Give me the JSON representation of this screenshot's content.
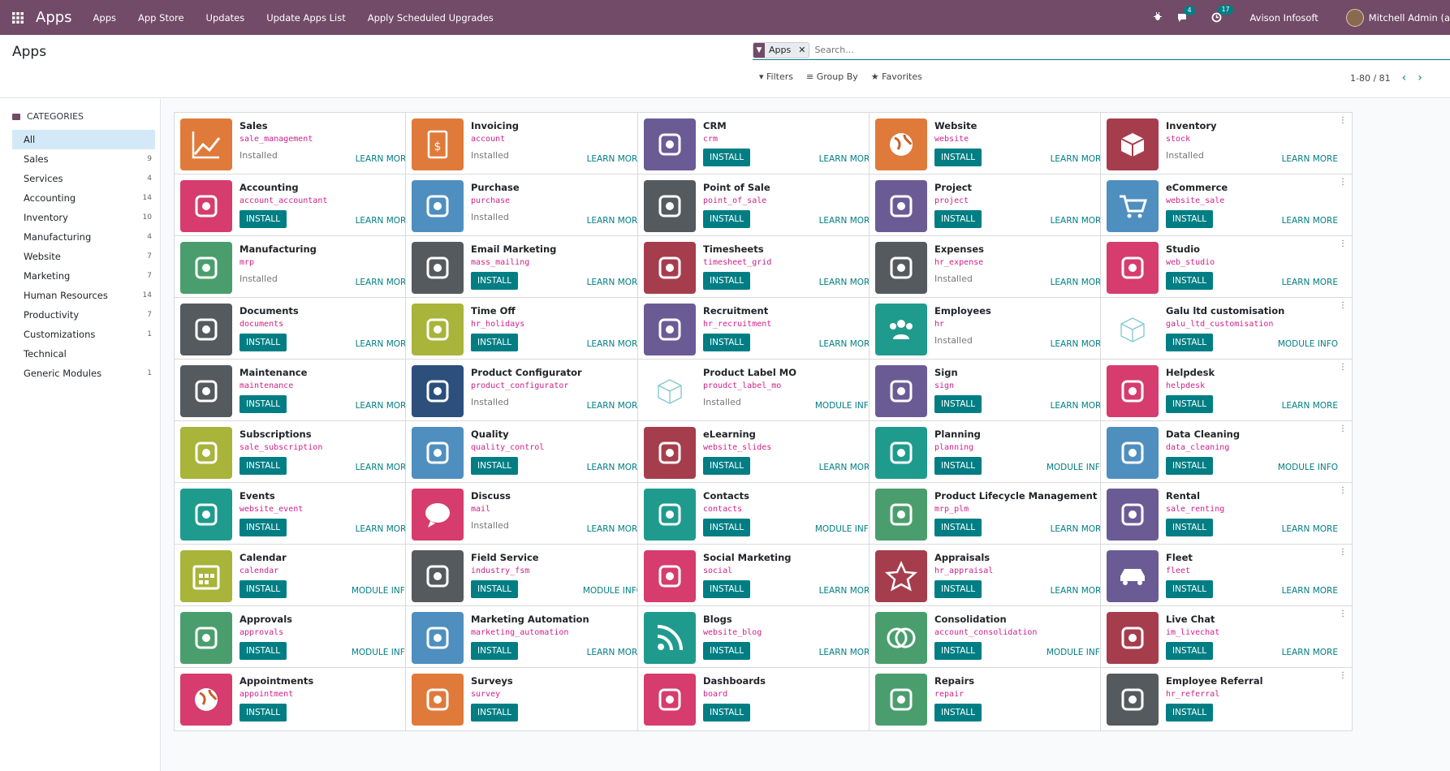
{
  "topbar": {
    "brand": "Apps",
    "menu": [
      "Apps",
      "App Store",
      "Updates",
      "Update Apps List",
      "Apply Scheduled Upgrades"
    ],
    "messages_count": "4",
    "activities_count": "17",
    "company": "Avison Infosoft",
    "user": "Mitchell Admin (a"
  },
  "control": {
    "title": "Apps",
    "facet_label": "Apps",
    "search_placeholder": "Search...",
    "filters": "Filters",
    "group_by": "Group By",
    "favorites": "Favorites",
    "pager": "1-80 / 81"
  },
  "sidebar": {
    "heading": "CATEGORIES",
    "items": [
      {
        "label": "All",
        "count": ""
      },
      {
        "label": "Sales",
        "count": "9"
      },
      {
        "label": "Services",
        "count": "4"
      },
      {
        "label": "Accounting",
        "count": "14"
      },
      {
        "label": "Inventory",
        "count": "10"
      },
      {
        "label": "Manufacturing",
        "count": "4"
      },
      {
        "label": "Website",
        "count": "7"
      },
      {
        "label": "Marketing",
        "count": "7"
      },
      {
        "label": "Human Resources",
        "count": "14"
      },
      {
        "label": "Productivity",
        "count": "7"
      },
      {
        "label": "Customizations",
        "count": "1"
      },
      {
        "label": "Technical",
        "count": ""
      },
      {
        "label": "Generic Modules",
        "count": "1"
      }
    ]
  },
  "labels": {
    "install": "INSTALL",
    "installed": "Installed"
  },
  "apps": [
    {
      "name": "Sales",
      "tech": "sale_management",
      "installed": true,
      "link": "LEARN MORE",
      "color": "#e07a3a",
      "icon": "chart-icon"
    },
    {
      "name": "Invoicing",
      "tech": "account",
      "installed": true,
      "link": "LEARN MORE",
      "color": "#e07a3a",
      "icon": "invoice-icon"
    },
    {
      "name": "CRM",
      "tech": "crm",
      "installed": false,
      "link": "LEARN MORE",
      "color": "#6b5b95",
      "icon": "handshake-icon"
    },
    {
      "name": "Website",
      "tech": "website",
      "installed": false,
      "link": "LEARN MORE",
      "color": "#e07a3a",
      "icon": "globe-icon"
    },
    {
      "name": "Inventory",
      "tech": "stock",
      "installed": true,
      "link": "LEARN MORE",
      "color": "#a63d4d",
      "icon": "box-icon"
    },
    {
      "name": "Accounting",
      "tech": "account_accountant",
      "installed": false,
      "link": "LEARN MORE",
      "color": "#d63c6e",
      "icon": "document-gear-icon"
    },
    {
      "name": "Purchase",
      "tech": "purchase",
      "installed": true,
      "link": "LEARN MORE",
      "color": "#4f8fbf",
      "icon": "card-icon"
    },
    {
      "name": "Point of Sale",
      "tech": "point_of_sale",
      "installed": false,
      "link": "LEARN MORE",
      "color": "#555a5e",
      "icon": "shop-icon"
    },
    {
      "name": "Project",
      "tech": "project",
      "installed": false,
      "link": "LEARN MORE",
      "color": "#6b5b95",
      "icon": "puzzle-icon"
    },
    {
      "name": "eCommerce",
      "tech": "website_sale",
      "installed": false,
      "link": "LEARN MORE",
      "color": "#4f8fbf",
      "icon": "cart-icon"
    },
    {
      "name": "Manufacturing",
      "tech": "mrp",
      "installed": true,
      "link": "LEARN MORE",
      "color": "#4a9e6e",
      "icon": "wrench-icon"
    },
    {
      "name": "Email Marketing",
      "tech": "mass_mailing",
      "installed": false,
      "link": "LEARN MORE",
      "color": "#555a5e",
      "icon": "paper-plane-icon"
    },
    {
      "name": "Timesheets",
      "tech": "timesheet_grid",
      "installed": false,
      "link": "LEARN MORE",
      "color": "#a63d4d",
      "icon": "stopwatch-icon"
    },
    {
      "name": "Expenses",
      "tech": "hr_expense",
      "installed": true,
      "link": "LEARN MORE",
      "color": "#555a5e",
      "icon": "person-dollar-icon"
    },
    {
      "name": "Studio",
      "tech": "web_studio",
      "installed": false,
      "link": "LEARN MORE",
      "color": "#d63c6e",
      "icon": "tools-icon"
    },
    {
      "name": "Documents",
      "tech": "documents",
      "installed": false,
      "link": "LEARN MORE",
      "color": "#555a5e",
      "icon": "inbox-icon"
    },
    {
      "name": "Time Off",
      "tech": "hr_holidays",
      "installed": false,
      "link": "LEARN MORE",
      "color": "#a8b43a",
      "icon": "person-sun-icon"
    },
    {
      "name": "Recruitment",
      "tech": "hr_recruitment",
      "installed": false,
      "link": "LEARN MORE",
      "color": "#6b5b95",
      "icon": "magnifier-icon"
    },
    {
      "name": "Employees",
      "tech": "hr",
      "installed": true,
      "link": "LEARN MORE",
      "color": "#1f9b8e",
      "icon": "people-icon"
    },
    {
      "name": "Galu ltd customisation",
      "tech": "galu_ltd_customisation",
      "installed": false,
      "link": "MODULE INFO",
      "color": "#ffffff",
      "icon": "cube-outline-icon"
    },
    {
      "name": "Maintenance",
      "tech": "maintenance",
      "installed": false,
      "link": "LEARN MORE",
      "color": "#555a5e",
      "icon": "hammer-icon"
    },
    {
      "name": "Product Configurator",
      "tech": "product_configurator",
      "installed": true,
      "link": "LEARN MORE",
      "color": "#2c4f7c",
      "icon": "monitor-gear-icon"
    },
    {
      "name": "Product Label MO",
      "tech": "proudct_label_mo",
      "installed": true,
      "link": "MODULE INFO",
      "color": "#ffffff",
      "icon": "cube-outline-icon"
    },
    {
      "name": "Sign",
      "tech": "sign",
      "installed": false,
      "link": "LEARN MORE",
      "color": "#6b5b95",
      "icon": "signature-icon"
    },
    {
      "name": "Helpdesk",
      "tech": "helpdesk",
      "installed": false,
      "link": "LEARN MORE",
      "color": "#d63c6e",
      "icon": "lifebuoy-icon"
    },
    {
      "name": "Subscriptions",
      "tech": "sale_subscription",
      "installed": false,
      "link": "LEARN MORE",
      "color": "#a8b43a",
      "icon": "recurring-dollar-icon"
    },
    {
      "name": "Quality",
      "tech": "quality_control",
      "installed": false,
      "link": "LEARN MORE",
      "color": "#4f8fbf",
      "icon": "quality-badge-icon"
    },
    {
      "name": "eLearning",
      "tech": "website_slides",
      "installed": false,
      "link": "LEARN MORE",
      "color": "#a63d4d",
      "icon": "presenter-icon"
    },
    {
      "name": "Planning",
      "tech": "planning",
      "installed": false,
      "link": "MODULE INFO",
      "color": "#1f9b8e",
      "icon": "planning-icon"
    },
    {
      "name": "Data Cleaning",
      "tech": "data_cleaning",
      "installed": false,
      "link": "MODULE INFO",
      "color": "#4f8fbf",
      "icon": "broom-icon"
    },
    {
      "name": "Events",
      "tech": "website_event",
      "installed": false,
      "link": "LEARN MORE",
      "color": "#1f9b8e",
      "icon": "tickets-icon"
    },
    {
      "name": "Discuss",
      "tech": "mail",
      "installed": true,
      "link": "LEARN MORE",
      "color": "#d63c6e",
      "icon": "chat-bubble-icon"
    },
    {
      "name": "Contacts",
      "tech": "contacts",
      "installed": false,
      "link": "MODULE INFO",
      "color": "#1f9b8e",
      "icon": "address-book-icon"
    },
    {
      "name": "Product Lifecycle Management (PL...",
      "tech": "mrp_plm",
      "installed": false,
      "link": "LEARN MORE",
      "color": "#4a9e6e",
      "icon": "cycle-box-icon"
    },
    {
      "name": "Rental",
      "tech": "sale_renting",
      "installed": false,
      "link": "LEARN MORE",
      "color": "#6b5b95",
      "icon": "calendar-grid-icon"
    },
    {
      "name": "Calendar",
      "tech": "calendar",
      "installed": false,
      "link": "MODULE INFO",
      "color": "#a8b43a",
      "icon": "calendar-icon"
    },
    {
      "name": "Field Service",
      "tech": "industry_fsm",
      "installed": false,
      "link": "MODULE INFO",
      "color": "#555a5e",
      "icon": "puzzle-clock-icon"
    },
    {
      "name": "Social Marketing",
      "tech": "social",
      "installed": false,
      "link": "LEARN MORE",
      "color": "#d63c6e",
      "icon": "thumbs-up-icon"
    },
    {
      "name": "Appraisals",
      "tech": "hr_appraisal",
      "installed": false,
      "link": "LEARN MORE",
      "color": "#a63d4d",
      "icon": "star-icon"
    },
    {
      "name": "Fleet",
      "tech": "fleet",
      "installed": false,
      "link": "LEARN MORE",
      "color": "#6b5b95",
      "icon": "car-icon"
    },
    {
      "name": "Approvals",
      "tech": "approvals",
      "installed": false,
      "link": "MODULE INFO",
      "color": "#4a9e6e",
      "icon": "person-check-icon"
    },
    {
      "name": "Marketing Automation",
      "tech": "marketing_automation",
      "installed": false,
      "link": "LEARN MORE",
      "color": "#4f8fbf",
      "icon": "gear-mail-icon"
    },
    {
      "name": "Blogs",
      "tech": "website_blog",
      "installed": false,
      "link": "LEARN MORE",
      "color": "#1f9b8e",
      "icon": "rss-icon"
    },
    {
      "name": "Consolidation",
      "tech": "account_consolidation",
      "installed": false,
      "link": "MODULE INFO",
      "color": "#4a9e6e",
      "icon": "circles-icon"
    },
    {
      "name": "Live Chat",
      "tech": "im_livechat",
      "installed": false,
      "link": "LEARN MORE",
      "color": "#a63d4d",
      "icon": "chat-bubbles-icon"
    },
    {
      "name": "Appointments",
      "tech": "appointment",
      "installed": false,
      "link": "",
      "color": "#d63c6e",
      "icon": "globe-icon"
    },
    {
      "name": "Surveys",
      "tech": "survey",
      "installed": false,
      "link": "",
      "color": "#e07a3a",
      "icon": "clipboard-icon"
    },
    {
      "name": "Dashboards",
      "tech": "board",
      "installed": false,
      "link": "",
      "color": "#d63c6e",
      "icon": "dashboard-icon"
    },
    {
      "name": "Repairs",
      "tech": "repair",
      "installed": false,
      "link": "",
      "color": "#4a9e6e",
      "icon": "wrench-icon"
    },
    {
      "name": "Employee Referral",
      "tech": "hr_referral",
      "installed": false,
      "link": "",
      "color": "#555a5e",
      "icon": "person-icon"
    }
  ]
}
